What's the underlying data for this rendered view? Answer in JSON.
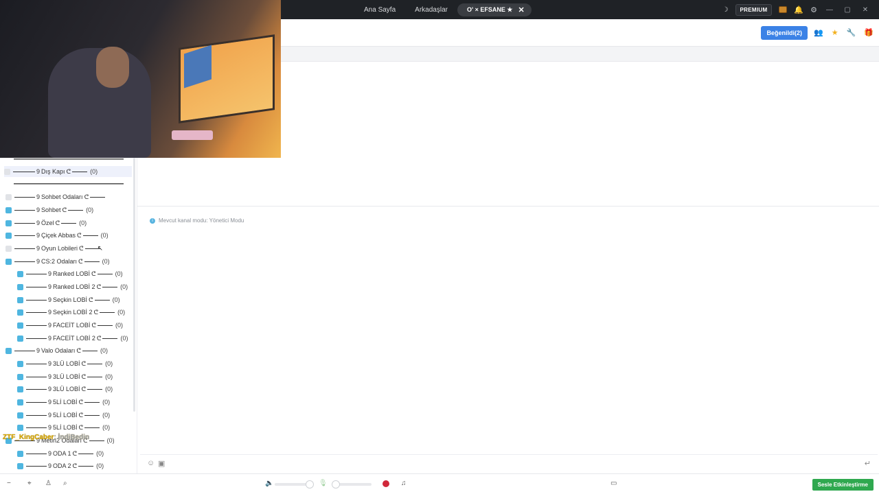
{
  "topbar": {
    "nav": [
      "Ana Sayfa",
      "Arkadaşlar"
    ],
    "active_tab": "O' × EFSANE ★",
    "close": "✕",
    "premium": "PREMIUM",
    "window": [
      "—",
      "▢",
      "✕"
    ]
  },
  "toolbar": {
    "likes": "Beğenildi(2)"
  },
  "sidebar": {
    "rows": [
      {
        "label": "Dış Kapı",
        "count": "(0)"
      },
      {
        "label": "Sohbet Odaları",
        "count": ""
      },
      {
        "label": "Sohbet",
        "count": "(0)"
      },
      {
        "label": "Özel",
        "count": "(0)"
      },
      {
        "label": "Çiçek Abbas",
        "count": "(0)"
      },
      {
        "label": "Oyun Lobileri",
        "count": ""
      },
      {
        "label": "CS:2 Odaları",
        "count": "(0)"
      },
      {
        "label": "Ranked LOBİ",
        "count": "(0)"
      },
      {
        "label": "Ranked LOBİ 2",
        "count": "(0)"
      },
      {
        "label": "Seçkin LOBİ",
        "count": "(0)"
      },
      {
        "label": "Seçkin LOBİ 2",
        "count": "(0)"
      },
      {
        "label": "FACEİT LOBİ",
        "count": "(0)"
      },
      {
        "label": "FACEİT LOBİ 2",
        "count": "(0)"
      },
      {
        "label": "Valo Odaları",
        "count": "(0)"
      },
      {
        "label": "3LÜ LOBİ",
        "count": "(0)"
      },
      {
        "label": "3LÜ LOBİ",
        "count": "(0)"
      },
      {
        "label": "3LÜ LOBİ",
        "count": "(0)"
      },
      {
        "label": "5Lİ LOBİ",
        "count": "(0)"
      },
      {
        "label": "5Lİ LOBİ",
        "count": "(0)"
      },
      {
        "label": "5Lİ LOBİ",
        "count": "(0)"
      },
      {
        "label": "Metin2 Odaları",
        "count": "(0)"
      },
      {
        "label": "ODA 1",
        "count": "(0)"
      },
      {
        "label": "ODA 2",
        "count": "(0)"
      }
    ]
  },
  "overlay": {
    "name": "ZTF_KingCaber",
    "suffix": ": İndiBedin"
  },
  "main": {
    "mode_info": "Mevcut kanal modu: Yönetici Modu"
  },
  "bottom": {
    "voice_button": "Sesle Etkinleştirme"
  },
  "colors": {
    "accent": "#3b82e6",
    "green": "#2fa84f",
    "check": "#4fb6e0"
  }
}
